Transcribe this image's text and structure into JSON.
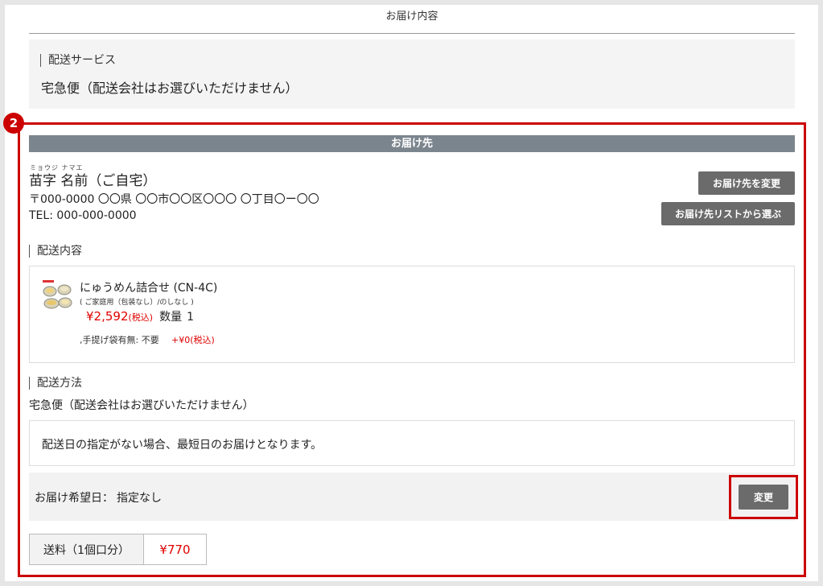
{
  "header": {
    "title": "お届け内容"
  },
  "service": {
    "label": "配送サービス",
    "value": "宅急便（配送会社はお選びいただけません）"
  },
  "step_number": "2",
  "destination": {
    "header": "お届け先",
    "ruby": "ミョウジ ナマエ",
    "name": "苗字 名前（ご自宅）",
    "address": "〒000-0000 〇〇県 〇〇市〇〇区〇〇〇 〇丁目〇ー〇〇",
    "tel": "TEL: 000-000-0000",
    "change_button": "お届け先を変更",
    "list_button": "お届け先リストから選ぶ"
  },
  "delivery_contents": {
    "label": "配送内容",
    "item": {
      "name": "にゅうめん詰合せ (CN-4C)",
      "options": "( ご家庭用（包装なし）/のしなし )",
      "price": "¥2,592",
      "tax_note": "(税込)",
      "quantity_label": "数量",
      "quantity": "1",
      "bag_label": ",手提げ袋有無: 不要",
      "bag_price": "+¥0(税込)"
    }
  },
  "delivery_method": {
    "label": "配送方法",
    "value": "宅急便（配送会社はお選びいただけません）",
    "note": "配送日の指定がない場合、最短日のお届けとなります。",
    "date_label": "お届け希望日：",
    "date_value": "指定なし",
    "change_button": "変更"
  },
  "shipping_fee": {
    "label": "送料（1個口分）",
    "value": "¥770"
  },
  "colors": {
    "accent_red": "#cc0000",
    "header_gray": "#7b858e",
    "button_gray": "#6b6b6b",
    "price_red": "#e00000"
  }
}
